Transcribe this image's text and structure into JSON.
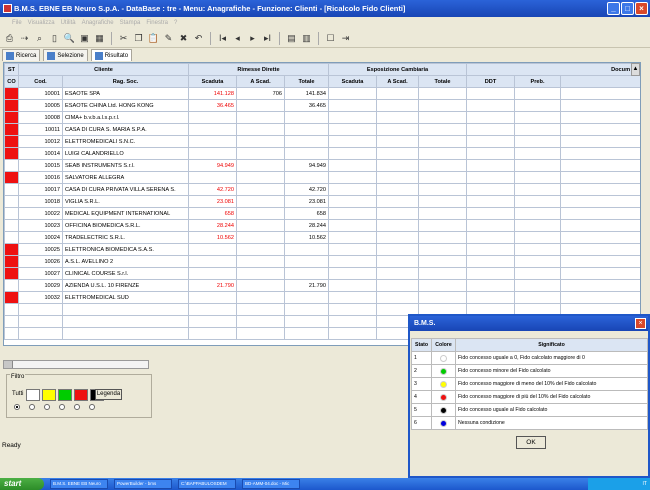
{
  "window": {
    "title": "B.M.S. EBNE EB Neuro S.p.A. - DataBase : tre - Menu: Anagrafiche - Funzione: Clienti - [Ricalcolo Fido Clienti]",
    "btn_min": "_",
    "btn_max": "□",
    "btn_close": "×"
  },
  "menubar": {
    "items": [
      "File",
      "Visualizza",
      "Utilità",
      "Anagrafiche",
      "Stampa",
      "Finestra",
      "?"
    ]
  },
  "toolbar": {
    "nav": [
      "I◂",
      "◂",
      "▸",
      "▸I"
    ]
  },
  "tabs": [
    {
      "label": "Ricerca"
    },
    {
      "label": "Selezione"
    },
    {
      "label": "Risultato"
    }
  ],
  "grid": {
    "groups": {
      "st": "ST",
      "cliente": "Cliente",
      "rimesse": "Rimesse Dirette",
      "esposizione": "Esposizione Cambiaria",
      "docum": "Docum"
    },
    "columns": {
      "co": "CO",
      "cod": "Cod.",
      "ragsoc": "Rag. Soc.",
      "scaduta": "Scaduta",
      "ascad": "A Scad.",
      "totale": "Totale",
      "scaduta2": "Scaduta",
      "ascad2": "A Scad.",
      "totale2": "Totale",
      "ddt": "DDT",
      "preb": "Preb."
    },
    "rows": [
      {
        "color": "red",
        "cod": "10001",
        "name": "ESAOTE SPA",
        "scaduta": "141.128",
        "ascad": "706",
        "totale": "141.834"
      },
      {
        "color": "red",
        "cod": "10005",
        "name": "ESAOTE CHINA Ltd. HONG KONG",
        "scaduta": "36.465",
        "ascad": "",
        "totale": "36.465"
      },
      {
        "color": "red",
        "cod": "10008",
        "name": "CIMA+ b.v.b.a.l.s.p.r.l.",
        "scaduta": "",
        "ascad": "",
        "totale": ""
      },
      {
        "color": "red",
        "cod": "10011",
        "name": "CASA DI CURA S. MARIA S.P.A.",
        "scaduta": "",
        "ascad": "",
        "totale": ""
      },
      {
        "color": "red",
        "cod": "10012",
        "name": "ELETTROMEDICALI S.N.C.",
        "scaduta": "",
        "ascad": "",
        "totale": ""
      },
      {
        "color": "red",
        "cod": "10014",
        "name": "LUIGI CALANDRIELLO",
        "scaduta": "",
        "ascad": "",
        "totale": ""
      },
      {
        "color": "white",
        "cod": "10015",
        "name": "SEAB INSTRUMENTS S.r.l.",
        "scaduta": "94.949",
        "ascad": "",
        "totale": "94.949"
      },
      {
        "color": "red",
        "cod": "10016",
        "name": "SALVATORE ALLEGRA",
        "scaduta": "",
        "ascad": "",
        "totale": ""
      },
      {
        "color": "white",
        "cod": "10017",
        "name": "CASA DI CURA PRIVATA VILLA SERENA S.",
        "scaduta": "42.720",
        "ascad": "",
        "totale": "42.720"
      },
      {
        "color": "white",
        "cod": "10018",
        "name": "VIGLIA S.R.L.",
        "scaduta": "23.081",
        "ascad": "",
        "totale": "23.081"
      },
      {
        "color": "white",
        "cod": "10022",
        "name": "MEDICAL EQUIPMENT INTERNATIONAL",
        "scaduta": "658",
        "ascad": "",
        "totale": "658"
      },
      {
        "color": "white",
        "cod": "10023",
        "name": "OFFICINA BIOMEDICA S.R.L.",
        "scaduta": "28.244",
        "ascad": "",
        "totale": "28.244"
      },
      {
        "color": "white",
        "cod": "10024",
        "name": "TRADELECTRIC S.R.L.",
        "scaduta": "10.562",
        "ascad": "",
        "totale": "10.562"
      },
      {
        "color": "red",
        "cod": "10025",
        "name": "ELETTRONICA BIOMEDICA S.A.S.",
        "scaduta": "",
        "ascad": "",
        "totale": ""
      },
      {
        "color": "red",
        "cod": "10026",
        "name": "A.S.L. AVELLINO 2",
        "scaduta": "",
        "ascad": "",
        "totale": ""
      },
      {
        "color": "red",
        "cod": "10027",
        "name": "CLINICAL COURSE S.r.l.",
        "scaduta": "",
        "ascad": "",
        "totale": ""
      },
      {
        "color": "white",
        "cod": "10029",
        "name": "AZIENDA U.S.L. 10 FIRENZE",
        "scaduta": "21.790",
        "ascad": "",
        "totale": "21.790"
      },
      {
        "color": "red",
        "cod": "10032",
        "name": "ELETTROMEDICAL SUD",
        "scaduta": "",
        "ascad": "",
        "totale": ""
      },
      {
        "color": "white",
        "cod": "",
        "name": "",
        "scaduta": "",
        "ascad": "",
        "totale": ""
      },
      {
        "color": "white",
        "cod": "",
        "name": "",
        "scaduta": "",
        "ascad": "",
        "totale": ""
      },
      {
        "color": "white",
        "cod": "",
        "name": "",
        "scaduta": "",
        "ascad": "",
        "totale": ""
      }
    ]
  },
  "filter": {
    "label": "Filtro",
    "tutti": "Tutti",
    "legend_button": "Legenda",
    "swatches": [
      "#ffffff",
      "#ffff00",
      "#00cc00",
      "#ee1111",
      "#000000"
    ]
  },
  "status": {
    "text": "Ready"
  },
  "dialog": {
    "title": "B.M.S.",
    "close": "×",
    "headers": {
      "stato": "Stato",
      "colore": "Colore",
      "significato": "Significato"
    },
    "rows": [
      {
        "stato": "1",
        "color": "#ffffff",
        "desc": "Fido concesso uguale a 0, Fido calcolato maggiore di 0"
      },
      {
        "stato": "2",
        "color": "#00cc00",
        "desc": "Fido concesso minore del Fido calcolato"
      },
      {
        "stato": "3",
        "color": "#ffff00",
        "desc": "Fido concesso maggiore di meno del 10% del Fido calcolato"
      },
      {
        "stato": "4",
        "color": "#ee1111",
        "desc": "Fido concesso maggiore di più del 10% del Fido calcolato"
      },
      {
        "stato": "5",
        "color": "#000000",
        "desc": "Fido concesso uguale al Fido calcolato"
      },
      {
        "stato": "6",
        "color": "#0000dd",
        "desc": "Nessuna condizione"
      }
    ],
    "ok": "OK"
  },
  "taskbar": {
    "start": "start",
    "tasks": [
      "B.M.S. EBNE EB Neuro",
      "PowerBuilder - bms",
      "C:\\BAPPABULOSDEM",
      "BD-AMM-04.doc - Mic"
    ],
    "tray": "IT"
  }
}
